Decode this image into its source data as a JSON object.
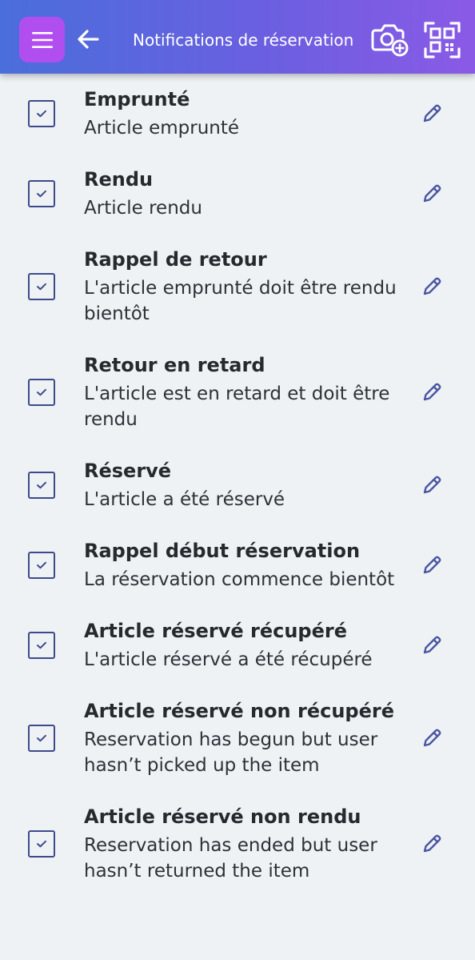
{
  "header": {
    "title": "Notifications de réservation",
    "menu_icon": "hamburger-menu-icon",
    "back_icon": "arrow-left-icon",
    "camera_icon": "camera-add-icon",
    "scan_icon": "qr-scan-icon",
    "gradient_start": "#4a6edb",
    "gradient_end": "#8a5ae6",
    "menu_button_color": "#b14ef0"
  },
  "notifications": [
    {
      "title": "Emprunté",
      "description": "Article emprunté",
      "checked": true
    },
    {
      "title": "Rendu",
      "description": "Article rendu",
      "checked": true
    },
    {
      "title": "Rappel de retour",
      "description": "L'article emprunté doit être rendu bientôt",
      "checked": true
    },
    {
      "title": "Retour en retard",
      "description": "L'article est en retard et doit être rendu",
      "checked": true
    },
    {
      "title": "Réservé",
      "description": "L'article a été réservé",
      "checked": true
    },
    {
      "title": "Rappel début réservation",
      "description": "La réservation commence bientôt",
      "checked": true
    },
    {
      "title": "Article réservé récupéré",
      "description": "L'article réservé a été récupéré",
      "checked": true
    },
    {
      "title": "Article réservé non récupéré",
      "description": "Reservation has begun but user hasn’t picked up the item",
      "checked": true
    },
    {
      "title": "Article réservé non rendu",
      "description": "Reservation has ended but user hasn’t returned the item",
      "checked": true
    }
  ],
  "colors": {
    "background": "#eef2f5",
    "checkbox": "#3d4a8a",
    "edit_icon": "#4a55a2"
  }
}
